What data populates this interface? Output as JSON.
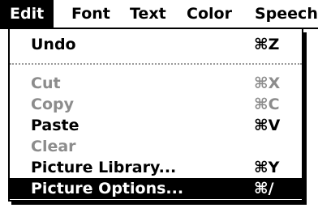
{
  "menubar": {
    "titles": [
      "Edit",
      "Font",
      "Text",
      "Color",
      "Speech"
    ]
  },
  "edit_menu": {
    "items": [
      {
        "label": "Undo",
        "shortcut": "⌘Z",
        "enabled": true
      },
      {
        "label": "Cut",
        "shortcut": "⌘X",
        "enabled": false
      },
      {
        "label": "Copy",
        "shortcut": "⌘C",
        "enabled": false
      },
      {
        "label": "Paste",
        "shortcut": "⌘V",
        "enabled": true
      },
      {
        "label": "Clear",
        "shortcut": "",
        "enabled": false
      },
      {
        "label": "Picture Library...",
        "shortcut": "⌘Y",
        "enabled": true
      },
      {
        "label": "Picture Options...",
        "shortcut": "⌘/",
        "enabled": true,
        "selected": true
      }
    ]
  }
}
